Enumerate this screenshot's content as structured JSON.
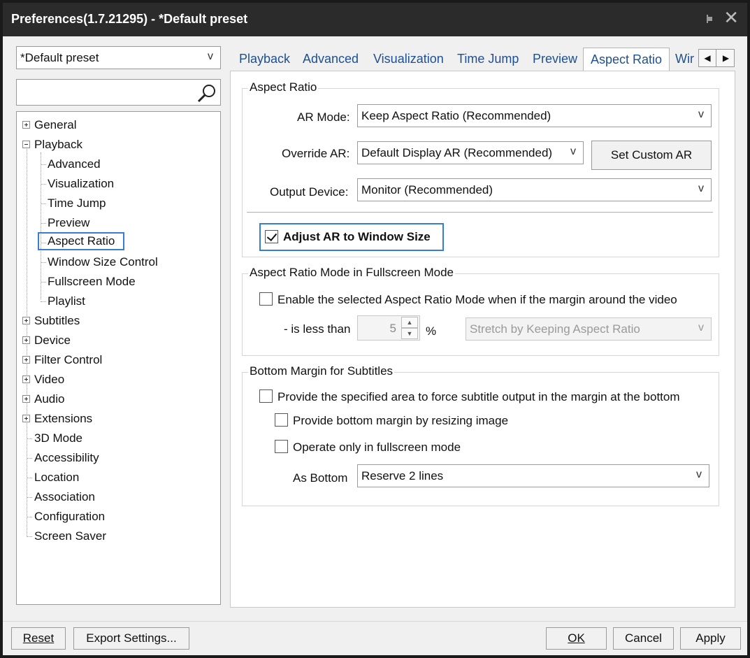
{
  "window": {
    "title": "Preferences(1.7.21295) - *Default preset"
  },
  "preset": {
    "selected": "*Default preset"
  },
  "search": {
    "placeholder": ""
  },
  "tree": {
    "items": [
      {
        "label": "General",
        "expander": "plus"
      },
      {
        "label": "Playback",
        "expander": "minus"
      },
      {
        "label": "Advanced"
      },
      {
        "label": "Visualization"
      },
      {
        "label": "Time Jump"
      },
      {
        "label": "Preview"
      },
      {
        "label": "Aspect Ratio",
        "selected": true
      },
      {
        "label": "Window Size Control"
      },
      {
        "label": "Fullscreen Mode"
      },
      {
        "label": "Playlist"
      },
      {
        "label": "Subtitles",
        "expander": "plus"
      },
      {
        "label": "Device",
        "expander": "plus"
      },
      {
        "label": "Filter Control",
        "expander": "plus"
      },
      {
        "label": "Video",
        "expander": "plus"
      },
      {
        "label": "Audio",
        "expander": "plus"
      },
      {
        "label": "Extensions",
        "expander": "plus"
      },
      {
        "label": "3D Mode"
      },
      {
        "label": "Accessibility"
      },
      {
        "label": "Location"
      },
      {
        "label": "Association"
      },
      {
        "label": "Configuration"
      },
      {
        "label": "Screen Saver"
      }
    ]
  },
  "tabs": [
    "Playback",
    "Advanced",
    "Visualization",
    "Time Jump",
    "Preview",
    "Aspect Ratio",
    "Wir"
  ],
  "aspect_ratio": {
    "legend": "Aspect Ratio",
    "ar_mode_label": "AR Mode:",
    "ar_mode_value": "Keep Aspect Ratio (Recommended)",
    "override_label": "Override AR:",
    "override_value": "Default Display AR (Recommended)",
    "set_custom_label": "Set Custom AR",
    "output_label": "Output Device:",
    "output_value": "Monitor (Recommended)",
    "adjust_label": "Adjust AR to Window Size",
    "adjust_checked": true
  },
  "fullscreen": {
    "legend": "Aspect Ratio Mode in Fullscreen Mode",
    "enable_label": "Enable the selected Aspect Ratio Mode when if the margin around the video",
    "less_than_label": "- is less than",
    "margin_value": "5",
    "percent": "%",
    "mode_value": "Stretch by Keeping Aspect Ratio"
  },
  "subtitles_margin": {
    "legend": "Bottom Margin for Subtitles",
    "provide_area_label": "Provide the specified area to force subtitle output in the margin at the bottom",
    "resize_label": "Provide bottom margin by resizing image",
    "fullscreen_only_label": "Operate only in fullscreen mode",
    "as_bottom_label": "As Bottom",
    "as_bottom_value": "Reserve 2 lines"
  },
  "footer": {
    "reset_label": "Reset",
    "export_label": "Export Settings...",
    "ok_label": "OK",
    "cancel_label": "Cancel",
    "apply_label": "Apply"
  },
  "icons": {
    "pin": "pin-icon",
    "close": "close-icon",
    "search": "magnifier-icon",
    "dropdown": "chevron-down-icon"
  }
}
